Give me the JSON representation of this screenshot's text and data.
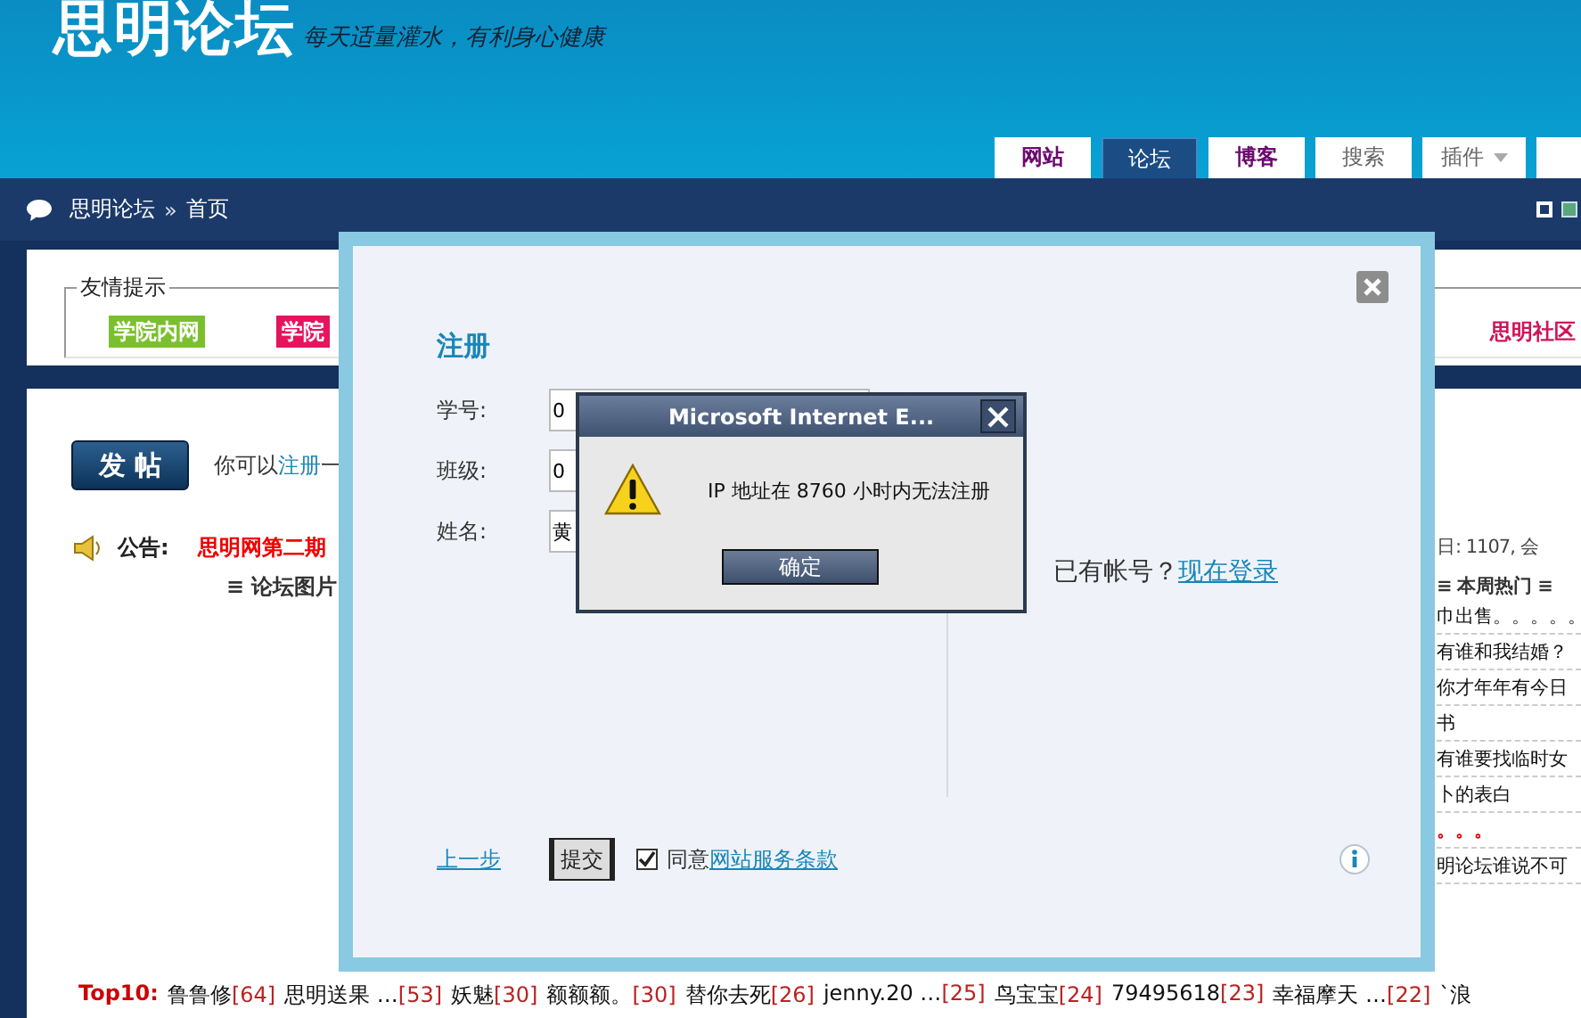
{
  "header": {
    "logo": "思明论坛",
    "slogan": "每天适量灌水，有利身心健康"
  },
  "nav_tabs": [
    {
      "label": "网站",
      "selected": false,
      "kind": "featured"
    },
    {
      "label": "论坛",
      "selected": true,
      "kind": "plain"
    },
    {
      "label": "博客",
      "selected": false,
      "kind": "featured"
    },
    {
      "label": "搜索",
      "selected": false,
      "kind": "plain"
    },
    {
      "label": "插件",
      "selected": false,
      "kind": "menu"
    },
    {
      "selected": false,
      "kind": "plain"
    }
  ],
  "breadcrumb": {
    "home": "思明论坛",
    "separator": "»",
    "current": "首页"
  },
  "notice_box": {
    "legend": "友情提示",
    "links": [
      {
        "label": "学院内网",
        "color": "#7bbf2e"
      },
      {
        "label": "学院",
        "color": "#e5145d"
      }
    ],
    "right_link": "思明社区"
  },
  "post_button": "发 帖",
  "register_hint": {
    "text": "你可以",
    "link": "注册",
    "rest": "一"
  },
  "announcement": {
    "label": "公告:",
    "text": "思明网第二期"
  },
  "stats": "日: 1107, 会",
  "left_section": "≡ 论坛图片",
  "hot_topics": {
    "title": "≡ 本周热门 ≡",
    "items": [
      {
        "title": "巾出售。。。。。",
        "highlight": false
      },
      {
        "title": "有谁和我结婚？",
        "highlight": false
      },
      {
        "title": "你才年年有今日",
        "highlight": false
      },
      {
        "title": "书",
        "highlight": false
      },
      {
        "title": "有谁要找临时女",
        "highlight": false
      },
      {
        "title": "卜的表白",
        "highlight": false
      },
      {
        "title": "。。。",
        "highlight": true
      },
      {
        "title": "明论坛谁说不可",
        "highlight": false
      }
    ]
  },
  "top10": {
    "label": "Top10:",
    "entries": [
      {
        "name": "鲁鲁修",
        "count": "[64]"
      },
      {
        "name": "思明送果 …",
        "count": "[53]"
      },
      {
        "name": "妖魅",
        "count": "[30]"
      },
      {
        "name": "额额额。",
        "count": "[30]"
      },
      {
        "name": "替你去死",
        "count": "[26]"
      },
      {
        "name": "jenny.20 …",
        "count": "[25]"
      },
      {
        "name": "鸟宝宝",
        "count": "[24]"
      },
      {
        "name": "79495618",
        "count": "[23]"
      },
      {
        "name": "幸福摩天 …",
        "count": "[22]"
      },
      {
        "name": "`浪"
      }
    ]
  },
  "register_dialog": {
    "title": "注册",
    "fields": [
      {
        "label": "学号:",
        "value": "0"
      },
      {
        "label": "班级:",
        "value": "0"
      },
      {
        "label": "姓名:",
        "value": "黄"
      }
    ],
    "login_prompt": "已有帐号？",
    "login_link": "现在登录",
    "back_link": "上一步",
    "submit": "提交",
    "agree": {
      "checked": true,
      "text": "同意",
      "link": "网站服务条款"
    }
  },
  "alert": {
    "title": "Microsoft Internet E...",
    "message": "IP 地址在 8760 小时内无法注册",
    "button": "确定"
  }
}
